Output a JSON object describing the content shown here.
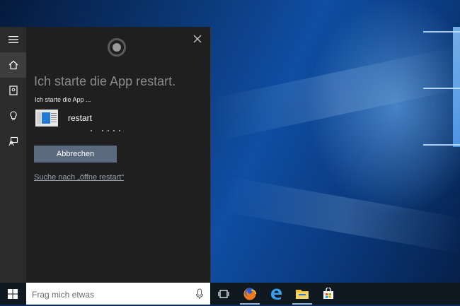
{
  "cortana": {
    "headline": "Ich starte die App restart.",
    "subhead": "Ich starte die App ...",
    "app_name": "restart",
    "cancel_label": "Abbrechen",
    "search_link": "Suche nach „öffne restart“"
  },
  "rail": {
    "items": [
      {
        "icon": "menu-icon"
      },
      {
        "icon": "home-icon"
      },
      {
        "icon": "notebook-icon"
      },
      {
        "icon": "lightbulb-icon"
      },
      {
        "icon": "feedback-icon"
      }
    ]
  },
  "taskbar": {
    "search_placeholder": "Frag mich etwas",
    "apps": [
      {
        "icon": "task-view-icon"
      },
      {
        "icon": "firefox-icon",
        "running": true
      },
      {
        "icon": "edge-icon"
      },
      {
        "icon": "file-explorer-icon",
        "running": true
      },
      {
        "icon": "store-icon"
      }
    ]
  },
  "colors": {
    "panel_bg": "#1f1f1f",
    "rail_bg": "#2b2b2b",
    "button_bg": "#5b6a7f",
    "accent": "#1f7ad6"
  }
}
